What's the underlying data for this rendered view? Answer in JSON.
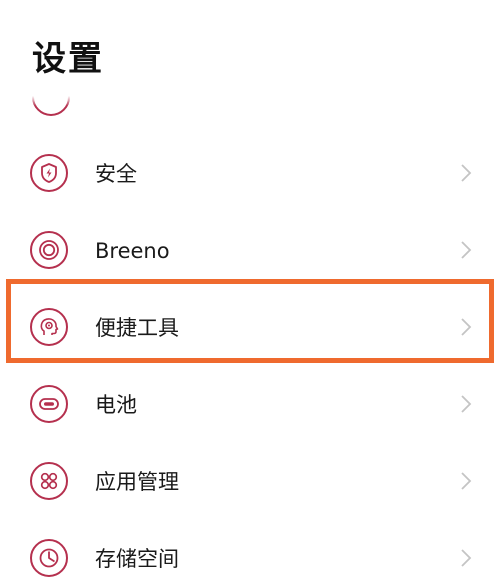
{
  "header": {
    "title": "设置"
  },
  "colors": {
    "icon_accent": "#b5304e",
    "highlight": "#ef6a2e",
    "chevron": "#c4c4c4"
  },
  "settings_items": [
    {
      "label": "安全",
      "icon": "shield-bolt-icon"
    },
    {
      "label": "Breeno",
      "icon": "breeno-rings-icon"
    },
    {
      "label": "便捷工具",
      "icon": "head-gear-icon",
      "highlighted": true
    },
    {
      "label": "电池",
      "icon": "battery-icon"
    },
    {
      "label": "应用管理",
      "icon": "app-grid-icon"
    },
    {
      "label": "存储空间",
      "icon": "storage-pie-icon"
    }
  ]
}
